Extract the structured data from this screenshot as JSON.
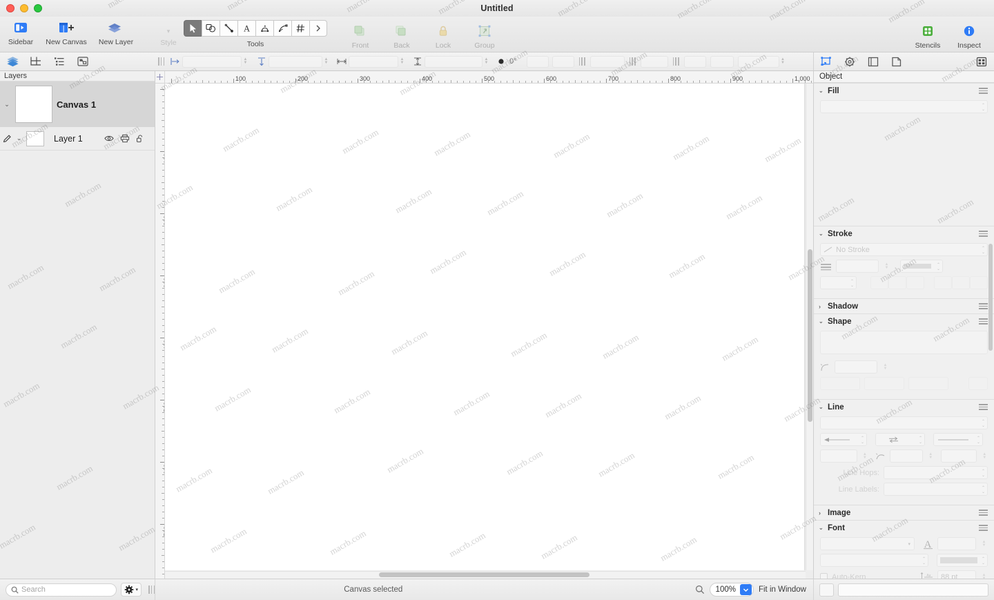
{
  "window": {
    "title": "Untitled",
    "traffic_lights": [
      "close-red",
      "minimize-yellow",
      "maximize-green"
    ]
  },
  "toolbar": {
    "items": [
      {
        "label": "Sidebar",
        "icon": "sidebar-icon",
        "enabled": true
      },
      {
        "label": "New Canvas",
        "icon": "new-canvas-icon",
        "enabled": true
      },
      {
        "label": "New Layer",
        "icon": "new-layer-icon",
        "enabled": true
      },
      {
        "label": "Style",
        "icon": "style-icon",
        "enabled": false
      },
      {
        "label": "Front",
        "icon": "bring-front-icon",
        "enabled": false
      },
      {
        "label": "Back",
        "icon": "send-back-icon",
        "enabled": false
      },
      {
        "label": "Lock",
        "icon": "lock-icon",
        "enabled": false
      },
      {
        "label": "Group",
        "icon": "group-icon",
        "enabled": false
      },
      {
        "label": "Stencils",
        "icon": "stencils-icon",
        "enabled": true
      },
      {
        "label": "Inspect",
        "icon": "inspect-info-icon",
        "enabled": true
      }
    ],
    "tools_label": "Tools",
    "tools": [
      {
        "name": "selection-tool",
        "icon": "arrow-cursor-icon",
        "active": true
      },
      {
        "name": "shape-tool",
        "icon": "shapes-icon",
        "active": false
      },
      {
        "name": "line-tool",
        "icon": "pencil-line-icon",
        "active": false
      },
      {
        "name": "text-tool",
        "icon": "letter-a-icon",
        "active": false
      },
      {
        "name": "freeform-tool",
        "icon": "polygon-icon",
        "active": false
      },
      {
        "name": "bezier-tool",
        "icon": "bezier-pen-icon",
        "active": false
      },
      {
        "name": "grid-tool",
        "icon": "grid-hash-icon",
        "active": false
      },
      {
        "name": "more-tools",
        "icon": "chevron-right-icon",
        "active": false
      }
    ]
  },
  "sidebar": {
    "header": "Layers",
    "canvas": {
      "name": "Canvas 1",
      "selected": true
    },
    "layer": {
      "name": "Layer 1",
      "controls": [
        "eye-visibility-icon",
        "printer-icon",
        "lock-open-icon"
      ],
      "pencil": "pencil-edit-icon"
    }
  },
  "second_bar": {
    "left_icons": [
      "layers-stack-icon",
      "canvas-frame-icon",
      "outline-list-icon",
      "shared-layers-icon"
    ],
    "rotation_value": "0°",
    "inspector_tabs": [
      "object-inspector-icon",
      "properties-gear-icon",
      "canvas-inspector-icon",
      "document-inspector-icon"
    ],
    "grid_button": "inspector-grid-icon"
  },
  "rulers": {
    "unit_step": 100,
    "h_labels": [
      "100",
      "200",
      "300",
      "400",
      "500",
      "600",
      "700",
      "800",
      "900",
      "1,000"
    ],
    "v_labels": [
      "100",
      "200",
      "300",
      "400",
      "500",
      "600",
      "700",
      "800"
    ]
  },
  "inspector": {
    "header": "Object",
    "sections": [
      {
        "key": "fill",
        "title": "Fill",
        "expanded": true
      },
      {
        "key": "stroke",
        "title": "Stroke",
        "expanded": true
      },
      {
        "key": "shadow",
        "title": "Shadow",
        "expanded": false
      },
      {
        "key": "shape",
        "title": "Shape",
        "expanded": true
      },
      {
        "key": "line",
        "title": "Line",
        "expanded": true
      },
      {
        "key": "image",
        "title": "Image",
        "expanded": false
      },
      {
        "key": "font",
        "title": "Font",
        "expanded": true
      }
    ],
    "stroke": {
      "type_value": "No Stroke"
    },
    "line": {
      "hops_label": "Line Hops:",
      "labels_label": "Line Labels:"
    },
    "font": {
      "auto_kern_label": "Auto-Kern",
      "auto_kern_checked": false,
      "line_spacing_value": "88 pt"
    }
  },
  "status_bar": {
    "search_placeholder": "Search",
    "gear_icon": "gear-settings-icon",
    "status_text": "Canvas selected",
    "zoom_icon": "magnifier-zoom-icon",
    "zoom_value": "100%",
    "fit_label": "Fit in Window"
  },
  "watermark": {
    "text": "macrb.com",
    "color": "#6e6e6e"
  }
}
